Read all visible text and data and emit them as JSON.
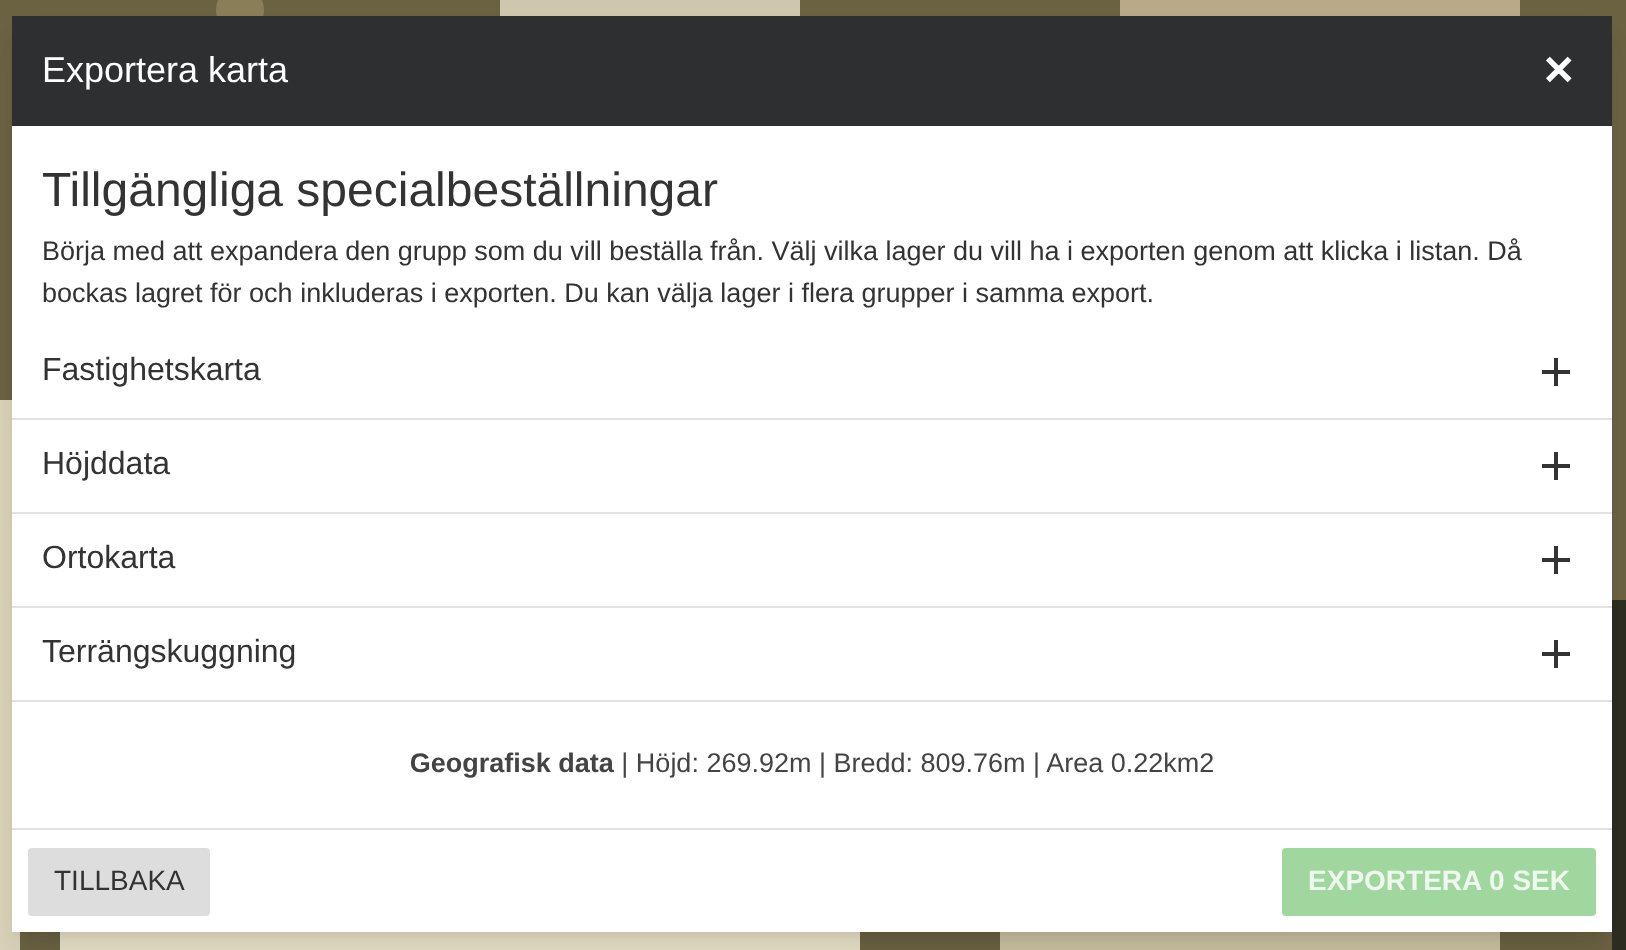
{
  "dialog": {
    "title": "Exportera karta",
    "close": "✕"
  },
  "heading": "Tillgängliga specialbeställningar",
  "intro": "Börja med att expandera den grupp som du vill beställa från. Välj vilka lager du vill ha i exporten genom att klicka i listan. Då bockas lagret för och inkluderas i exporten. Du kan välja lager i flera grupper i samma export.",
  "groups": [
    {
      "label": "Fastighetskarta",
      "expanded": false
    },
    {
      "label": "Höjddata",
      "expanded": false
    },
    {
      "label": "Ortokarta",
      "expanded": false
    },
    {
      "label": "Terrängskuggning",
      "expanded": false
    }
  ],
  "info": "**Geografisk data** | Höjd: 269.92m | Bredd: 809.76m | Area 0.22km2",
  "buttons": {
    "back": {
      "label": "TILLBAKA",
      "disabled": false
    },
    "export": {
      "label": "EXPORTERA 0 SEK",
      "disabled": true
    }
  }
}
